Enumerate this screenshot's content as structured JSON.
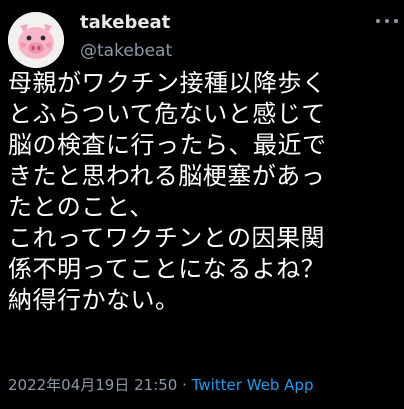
{
  "user": {
    "display_name": "takebeat",
    "handle": "@takebeat",
    "avatar_icon": "pig-avatar-icon"
  },
  "tweet": {
    "lines": [
      "母親がワクチン接種以降歩く",
      "とふらついて危ないと感じて",
      "脳の検査に行ったら、最近で",
      "きたと思われる脳梗塞があっ",
      "たとのこと、",
      "これってワクチンとの因果関",
      "係不明ってことになるよね？",
      "納得行かない。"
    ]
  },
  "meta": {
    "timestamp": "2022年04月19日 21:50",
    "separator": " · ",
    "source": "Twitter Web App"
  },
  "colors": {
    "background": "#000000",
    "text": "#ffffff",
    "secondary": "#8b98a5",
    "link": "#1d9bf0"
  }
}
